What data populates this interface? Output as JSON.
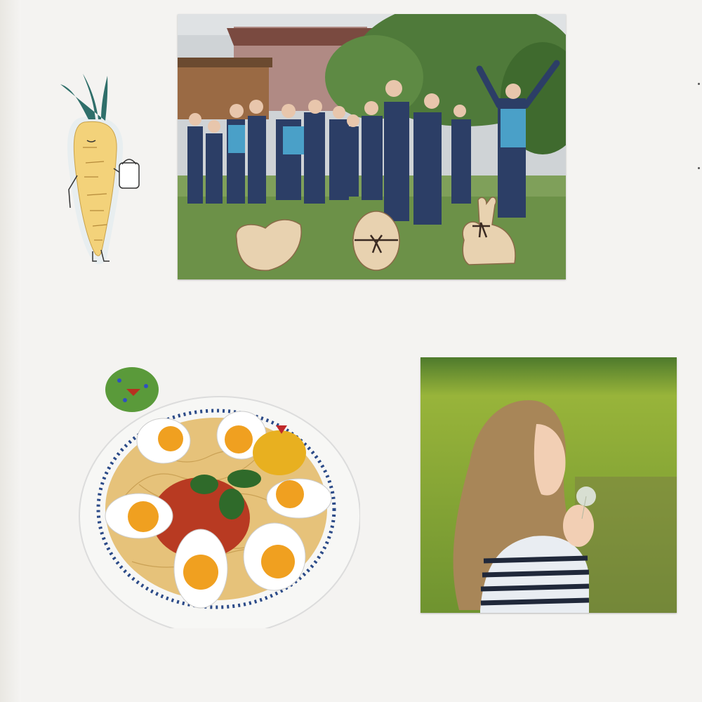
{
  "page": {
    "background_color": "#f4f3f1"
  },
  "stickers": {
    "carrot": {
      "icon": "carrot-character-icon",
      "body_color": "#f3d27a",
      "leaf_color": "#2f6f6a"
    },
    "chick_egg": {
      "icon": "green-chick-egg-icon",
      "color": "#5a9a3a"
    }
  },
  "wood_cutouts": [
    {
      "icon": "wooden-hen-icon"
    },
    {
      "icon": "wooden-egg-with-bow-icon"
    },
    {
      "icon": "wooden-bunny-icon"
    }
  ],
  "photos": {
    "group": {
      "subject": "group-photo",
      "people_count": 17
    },
    "child": {
      "subject": "child-blowing-dandelion-photo"
    },
    "plate": {
      "subject": "spaghetti-with-eggs-cutout",
      "egg_halves": 7
    }
  }
}
